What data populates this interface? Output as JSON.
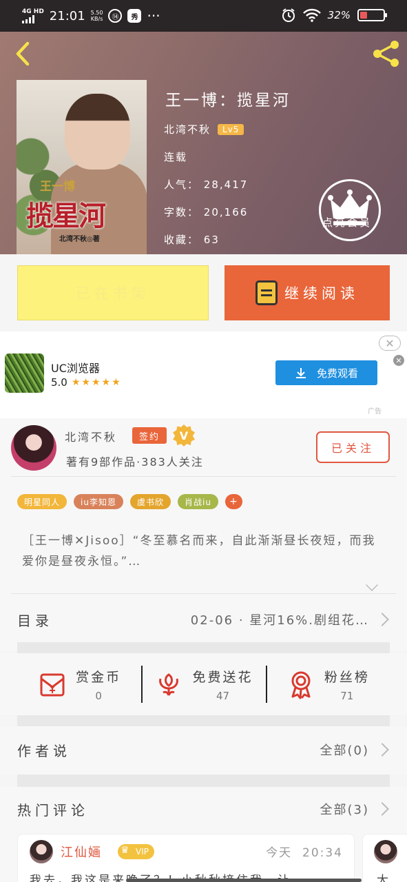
{
  "status_bar": {
    "network": "4G HD",
    "time": "21:01",
    "speed_value": "5.50",
    "speed_unit": "KB/s",
    "icon_a": "⑭",
    "icon_b": "秀",
    "more": "···",
    "battery": "32%",
    "battery_level": 0.32
  },
  "book": {
    "title": "王一博：揽星河",
    "author": "北湾不秋",
    "level": "Lv5",
    "status": "连载",
    "popularity_label": "人气：",
    "popularity": "28,417",
    "words_label": "字数：",
    "words": "20,166",
    "favorites_label": "收藏：",
    "favorites": "63",
    "cover_subtitle": "王一博",
    "cover_title": "揽星河",
    "cover_credit": "北湾不秋◎著"
  },
  "vip": {
    "label": "点亮会员"
  },
  "actions": {
    "shelf_label": "已在书架",
    "read_label": "继续阅读"
  },
  "ad": {
    "close": "✕",
    "dismiss": "✕",
    "name": "UC浏览器",
    "rating": "5.0",
    "stars": "★★★★★",
    "button": "免费观看",
    "tag": "广告"
  },
  "author": {
    "name": "北湾不秋",
    "signed_badge": "签约",
    "verified_badge": "V",
    "stats": "著有9部作品·383人关注",
    "follow_button": "已关注"
  },
  "tags": [
    {
      "label": "明星同人",
      "color": "#f2b63b"
    },
    {
      "label": "iu李知恩",
      "color": "#d9825a"
    },
    {
      "label": "虞书欣",
      "color": "#e4a52d"
    },
    {
      "label": "肖战iu",
      "color": "#a7b74a"
    },
    {
      "label": "+",
      "color": "#e9653a"
    }
  ],
  "synopsis": "［王一博✕Jisoo］“冬至慕名而来，自此渐渐昼长夜短，而我爱你是昼夜永恒。”…",
  "catalog": {
    "label": "目录",
    "latest": "02-06 · 星河16%.剧组花…"
  },
  "rewards": [
    {
      "label": "赏金币",
      "value": "0",
      "icon": "gift-envelope-icon"
    },
    {
      "label": "免费送花",
      "value": "47",
      "icon": "flower-icon"
    },
    {
      "label": "粉丝榜",
      "value": "71",
      "icon": "rank-medal-icon"
    }
  ],
  "author_says": {
    "label": "作者说",
    "all": "全部(0)"
  },
  "hot_comments": {
    "label": "热门评论",
    "all": "全部(3)"
  },
  "comments": [
    {
      "user": "江仙婳",
      "vip": "VIP",
      "date": "今天",
      "time": "20:34",
      "text": "我去，我这是来晚了？！小秋秋接住我，让"
    },
    {
      "text": "大"
    }
  ],
  "colors": {
    "accent": "#e9653a",
    "shelf_bg": "#fdf27b",
    "ad_button": "#1f8fe0"
  }
}
